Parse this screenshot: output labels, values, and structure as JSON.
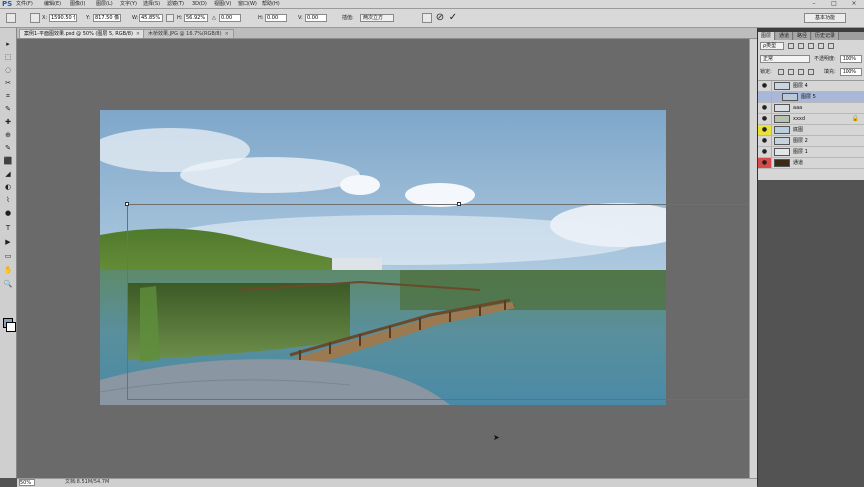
{
  "menubar": {
    "logo": "PS",
    "items": [
      "文件(F)",
      "编辑(E)",
      "图像(I)",
      "图层(L)",
      "文字(Y)",
      "选择(S)",
      "滤镜(T)",
      "3D(D)",
      "视图(V)",
      "窗口(W)",
      "帮助(H)"
    ],
    "minimize": "–",
    "maximize": "□",
    "close": "×"
  },
  "options": {
    "x_label": "X:",
    "x_value": "1590.50 像",
    "y_label": "Y:",
    "y_value": "817.50 像",
    "w_label": "W:",
    "w_value": "45.85%",
    "h_label": "H:",
    "h_value": "56.92%",
    "angle_label": "△",
    "angle_value": "0.00",
    "hskew_label": "H:",
    "hskew_value": "0.00",
    "vskew_label": "V:",
    "vskew_value": "0.00",
    "interp_label": "插值:",
    "interp_value": "两次立方",
    "cancel_glyph": "⊘",
    "commit_glyph": "✓",
    "workspace": "基本功能"
  },
  "doc_tabs": [
    {
      "label": "案例1-平面图效果.psd @ 50% (图层 5, RGB/8)",
      "close": "×"
    },
    {
      "label": "木桥效果.JPG @ 16.7%(RGB/8)",
      "close": "×"
    }
  ],
  "status": {
    "zoom": "50%",
    "doc_info": "文档:8.51M/54.7M"
  },
  "panel": {
    "tabs": [
      "图层",
      "通道",
      "路径",
      "历史记录"
    ],
    "filter_label": "ρ类型",
    "blend_mode": "正常",
    "opacity_label": "不透明度:",
    "opacity_value": "100%",
    "lock_label": "锁定:",
    "fill_label": "填充:",
    "fill_value": "100%",
    "layers": [
      {
        "name": "图层 4",
        "selected": false,
        "visible": true,
        "eye": "●",
        "locked": false
      },
      {
        "name": "图层 5",
        "selected": true,
        "visible": false,
        "eye": "",
        "locked": false
      },
      {
        "name": "aaa",
        "selected": false,
        "visible": true,
        "eye": "●",
        "locked": false
      },
      {
        "name": "xxxd",
        "selected": false,
        "visible": true,
        "eye": "●",
        "locked": true
      },
      {
        "name": "底图",
        "selected": false,
        "visible": true,
        "eye": "●",
        "locked": false
      },
      {
        "name": "图层 2",
        "selected": false,
        "visible": true,
        "eye": "●",
        "locked": false
      },
      {
        "name": "图层 1",
        "selected": false,
        "visible": true,
        "eye": "●",
        "locked": false
      },
      {
        "name": "通道",
        "selected": false,
        "visible": true,
        "eye": "●",
        "locked": false
      }
    ],
    "lock_glyph": "🔒"
  },
  "tools": [
    "▸",
    "⬚",
    "◌",
    "✂",
    "⌗",
    "✎",
    "✚",
    "⊕",
    "✎",
    "⬛",
    "◢",
    "◐",
    "⌇",
    "●",
    "T",
    "▶",
    "▭",
    "✋",
    "🔍"
  ],
  "colors": {
    "selected_layer": "#a9b8d9",
    "workspace_bg": "#6a6a6a",
    "eye_highlight": "#e8e23a",
    "eye_highlight_red": "#d94b4b"
  }
}
